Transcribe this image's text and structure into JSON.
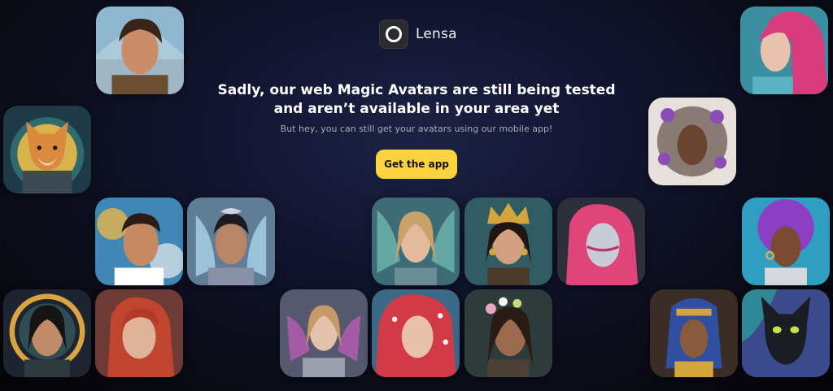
{
  "brand": {
    "name": "Lensa",
    "logo_icon": "lensa-ring-logo-icon"
  },
  "message": {
    "headline": "Sadly, our web Magic Avatars are still being tested\nand aren’t available in your area yet",
    "subline": "But hey, you can still get your avatars using our mobile app!"
  },
  "cta": {
    "label": "Get the app",
    "color": "#fcd33f"
  },
  "colors": {
    "background": "#0b0d1c",
    "headline_text": "#ffffff",
    "subline_text": "#a9aabb"
  },
  "avatars": [
    {
      "name": "brown-haired-man-mountains"
    },
    {
      "name": "shiba-inu-astronaut"
    },
    {
      "name": "young-man-colorful-paint"
    },
    {
      "name": "fairy-woman-blue-wings"
    },
    {
      "name": "woman-golden-halo"
    },
    {
      "name": "red-haired-woman"
    },
    {
      "name": "fairy-woman-purple-wings"
    },
    {
      "name": "blonde-woman-teal-wings"
    },
    {
      "name": "queen-golden-crown"
    },
    {
      "name": "pink-hair-silver-face"
    },
    {
      "name": "red-hair-mermaid-pearls"
    },
    {
      "name": "woman-flower-crown"
    },
    {
      "name": "pink-hair-mermaid"
    },
    {
      "name": "woman-flower-helmet"
    },
    {
      "name": "woman-purple-afro"
    },
    {
      "name": "pharaoh-man"
    },
    {
      "name": "black-cat-portrait"
    }
  ]
}
